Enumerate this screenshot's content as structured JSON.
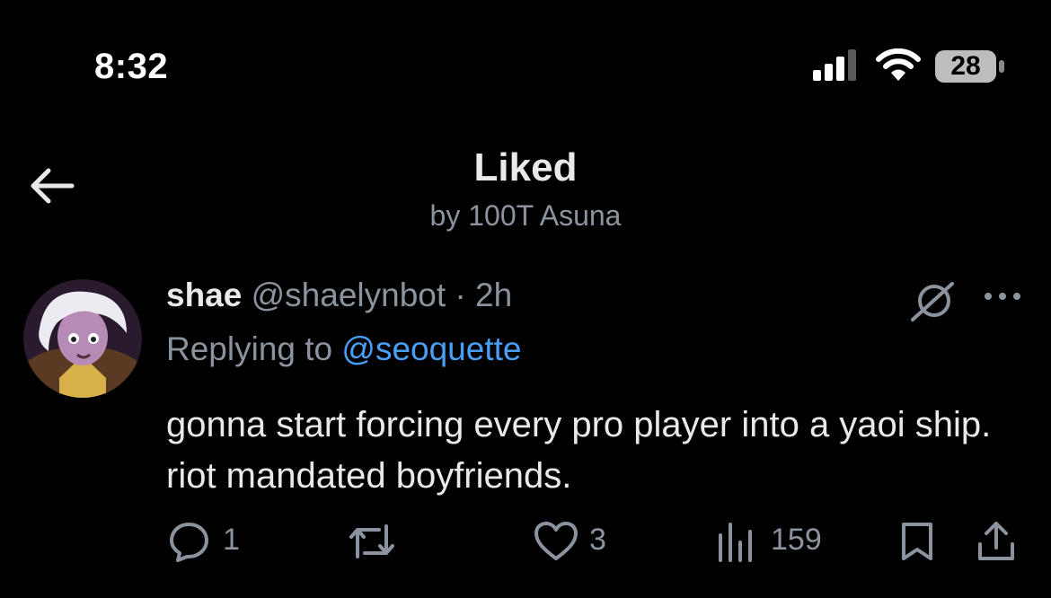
{
  "status_bar": {
    "time": "8:32",
    "battery": "28"
  },
  "header": {
    "title": "Liked",
    "subtitle": "by 100T Asuna"
  },
  "tweet": {
    "name": "shae",
    "handle": "@shaelynbot",
    "separator": "·",
    "age": "2h",
    "replying_prefix": "Replying to",
    "replying_to": "@seoquette",
    "text": "gonna start forcing every pro player into a yaoi ship. riot mandated boyfriends.",
    "actions": {
      "replies": "1",
      "likes": "3",
      "views": "159"
    }
  },
  "icons": {
    "back": "arrow-left-icon",
    "grok": "grok-icon",
    "more": "more-dots-icon",
    "reply": "reply-bubble-icon",
    "retweet": "retweet-icon",
    "like": "heart-icon",
    "views": "views-chart-icon",
    "bookmark": "bookmark-icon",
    "share": "share-icon"
  },
  "colors": {
    "accent": "#4a9ff5",
    "muted": "#8b949e",
    "background": "#000000"
  }
}
